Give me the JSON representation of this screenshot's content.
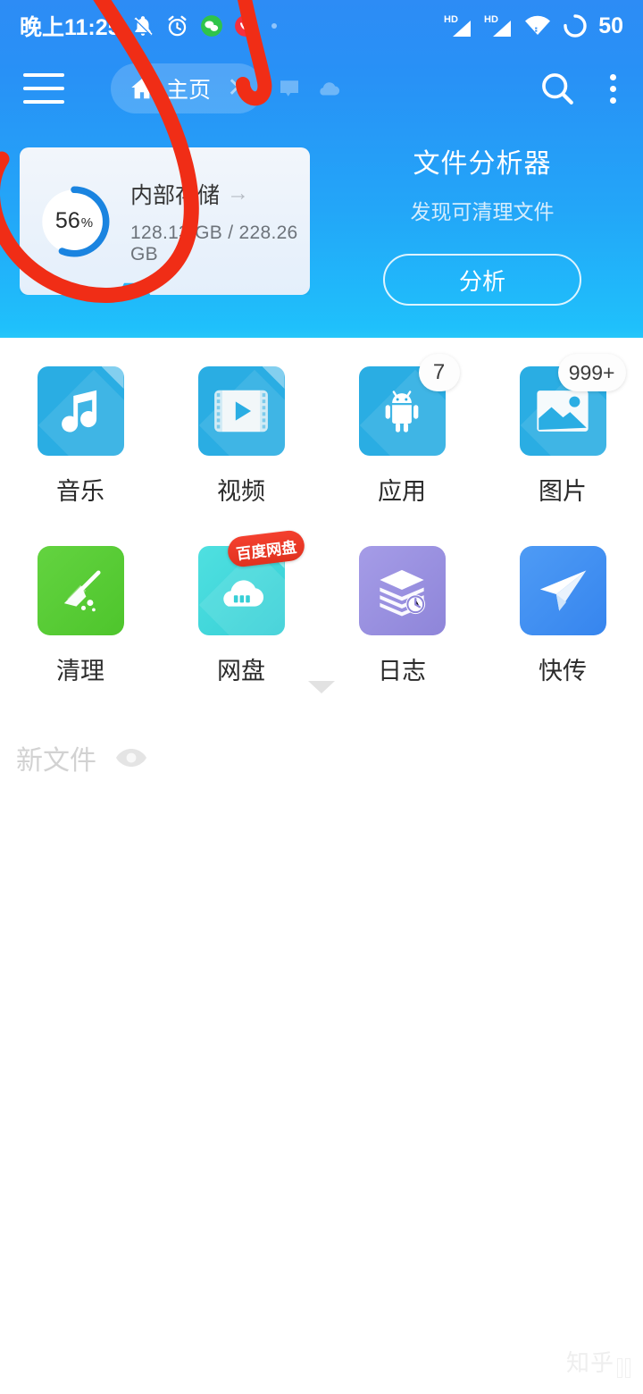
{
  "statusbar": {
    "time": "晚上11:25",
    "left_icons": [
      "bell-muted-icon",
      "alarm-clock-icon",
      "wechat-icon",
      "red-app-icon",
      "dot-icon"
    ],
    "right_icons": [
      "hd-signal-icon",
      "hd-signal-icon",
      "wifi-icon",
      "battery-ring-icon"
    ],
    "battery_level": "50"
  },
  "navbar": {
    "menu_icon": "hamburger-icon",
    "tab": {
      "label": "主页",
      "icon": "home-icon",
      "close": "✕"
    },
    "ghost_tabs": [
      "document-tab-icon",
      "cloud-tab-icon"
    ],
    "search_icon": "search-icon",
    "overflow_icon": "more-vertical-icon"
  },
  "storage": {
    "percent": "56",
    "percent_symbol": "%",
    "title": "内部存储",
    "arrow": "→",
    "usage": "128.13 GB / 228.26 GB",
    "ring_color": "#1a84e0",
    "ring_track": "#ffffff"
  },
  "analyzer": {
    "title": "文件分析器",
    "subtitle": "发现可清理文件",
    "button": "分析"
  },
  "grid": [
    {
      "label": "音乐",
      "icon": "music-note-icon",
      "shape": "file",
      "color": "#2aade3",
      "badge": null
    },
    {
      "label": "视频",
      "icon": "video-play-icon",
      "shape": "file",
      "color": "#2aade3",
      "badge": null
    },
    {
      "label": "应用",
      "icon": "android-robot-icon",
      "shape": "file",
      "color": "#2aade3",
      "badge": "7"
    },
    {
      "label": "图片",
      "icon": "picture-icon",
      "shape": "file",
      "color": "#2aade3",
      "badge": "999+"
    },
    {
      "label": "清理",
      "icon": "broom-icon",
      "shape": "square",
      "color": "#53c832",
      "badge": null
    },
    {
      "label": "网盘",
      "icon": "cloud-drive-icon",
      "shape": "file",
      "color": "#3fd7dd",
      "badge": null,
      "tag": "百度网盘"
    },
    {
      "label": "日志",
      "icon": "log-stack-clock-icon",
      "shape": "square",
      "color": "#9891e0",
      "badge": null
    },
    {
      "label": "快传",
      "icon": "paper-plane-icon",
      "shape": "square",
      "color": "#3f8ef0",
      "badge": null
    }
  ],
  "below": {
    "expand_icon": "chevron-down-icon",
    "new_files_label": "新文件",
    "eye_icon": "eye-icon"
  },
  "watermark": {
    "text": "知乎"
  },
  "colors": {
    "header_top": "#2d8cf5",
    "header_bottom": "#25c6fa",
    "annotation_red": "#f02d16",
    "badge_bg": "#fdfdfd",
    "tag_red": "#ee3a26"
  }
}
